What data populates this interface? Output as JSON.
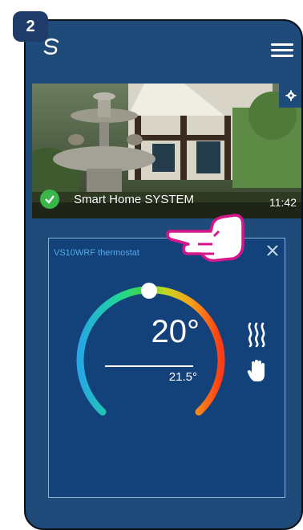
{
  "step": {
    "number": "2"
  },
  "icons": {
    "logo": "swirl-logo-icon",
    "menu": "hamburger-menu-icon",
    "settings": "gear-icon",
    "status": "check-icon",
    "close": "close-icon",
    "heating": "heat-waves-icon",
    "manual": "hand-icon",
    "pointer": "pointing-hand-icon"
  },
  "hero": {
    "system_name": "Smart Home SYSTEM",
    "time": "11:42"
  },
  "thermostat": {
    "title": "VS10WRF thermostat",
    "set_temp": "20°",
    "current_temp": "21.5°"
  },
  "colors": {
    "app_background": "#1e4b7a",
    "card_background": "#13427a",
    "status_green": "#38b64a",
    "title_blue": "#55a8ea"
  }
}
